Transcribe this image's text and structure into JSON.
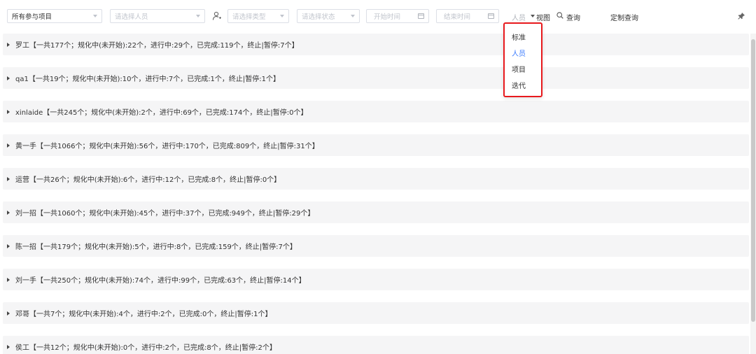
{
  "toolbar": {
    "project_select": {
      "value": "所有参与项目"
    },
    "person_select": {
      "placeholder": "请选择人员"
    },
    "type_select": {
      "placeholder": "请选择类型"
    },
    "status_select": {
      "placeholder": "请选择状态"
    },
    "start_time": {
      "placeholder": "开始时间"
    },
    "end_time": {
      "placeholder": "结束时间"
    },
    "view_value": "人员",
    "view_label": "视图",
    "query_label": "查询",
    "custom_query_label": "定制查询"
  },
  "view_menu": {
    "items": [
      {
        "label": "标准",
        "active": false
      },
      {
        "label": "人员",
        "active": true
      },
      {
        "label": "项目",
        "active": false
      },
      {
        "label": "迭代",
        "active": false
      }
    ],
    "highlight_color": "#e8191d",
    "active_color": "#3a7afe"
  },
  "rows": [
    {
      "label": "罗工【一共177个；规化中(未开始):22个，进行中:29个，已完成:119个，终止|暂停:7个】"
    },
    {
      "label": "qa1【一共19个；规化中(未开始):10个，进行中:7个，已完成:1个，终止|暂停:1个】"
    },
    {
      "label": "xinlaide【一共245个；规化中(未开始):2个，进行中:69个，已完成:174个，终止|暂停:0个】"
    },
    {
      "label": "黄一手【一共1066个；规化中(未开始):56个，进行中:170个，已完成:809个，终止|暂停:31个】"
    },
    {
      "label": "运营【一共26个；规化中(未开始):6个，进行中:12个，已完成:8个，终止|暂停:0个】"
    },
    {
      "label": "刘一招【一共1060个；规化中(未开始):45个，进行中:37个，已完成:949个，终止|暂停:29个】"
    },
    {
      "label": "陈一招【一共179个；规化中(未开始):5个，进行中:8个，已完成:159个，终止|暂停:7个】"
    },
    {
      "label": "刘一手【一共250个；规化中(未开始):74个，进行中:99个，已完成:63个，终止|暂停:14个】"
    },
    {
      "label": "邓哥【一共7个；规化中(未开始):4个，进行中:2个，已完成:0个，终止|暂停:1个】"
    },
    {
      "label": "侯工【一共12个；规化中(未开始):0个，进行中:2个，已完成:8个，终止|暂停:2个】"
    }
  ]
}
